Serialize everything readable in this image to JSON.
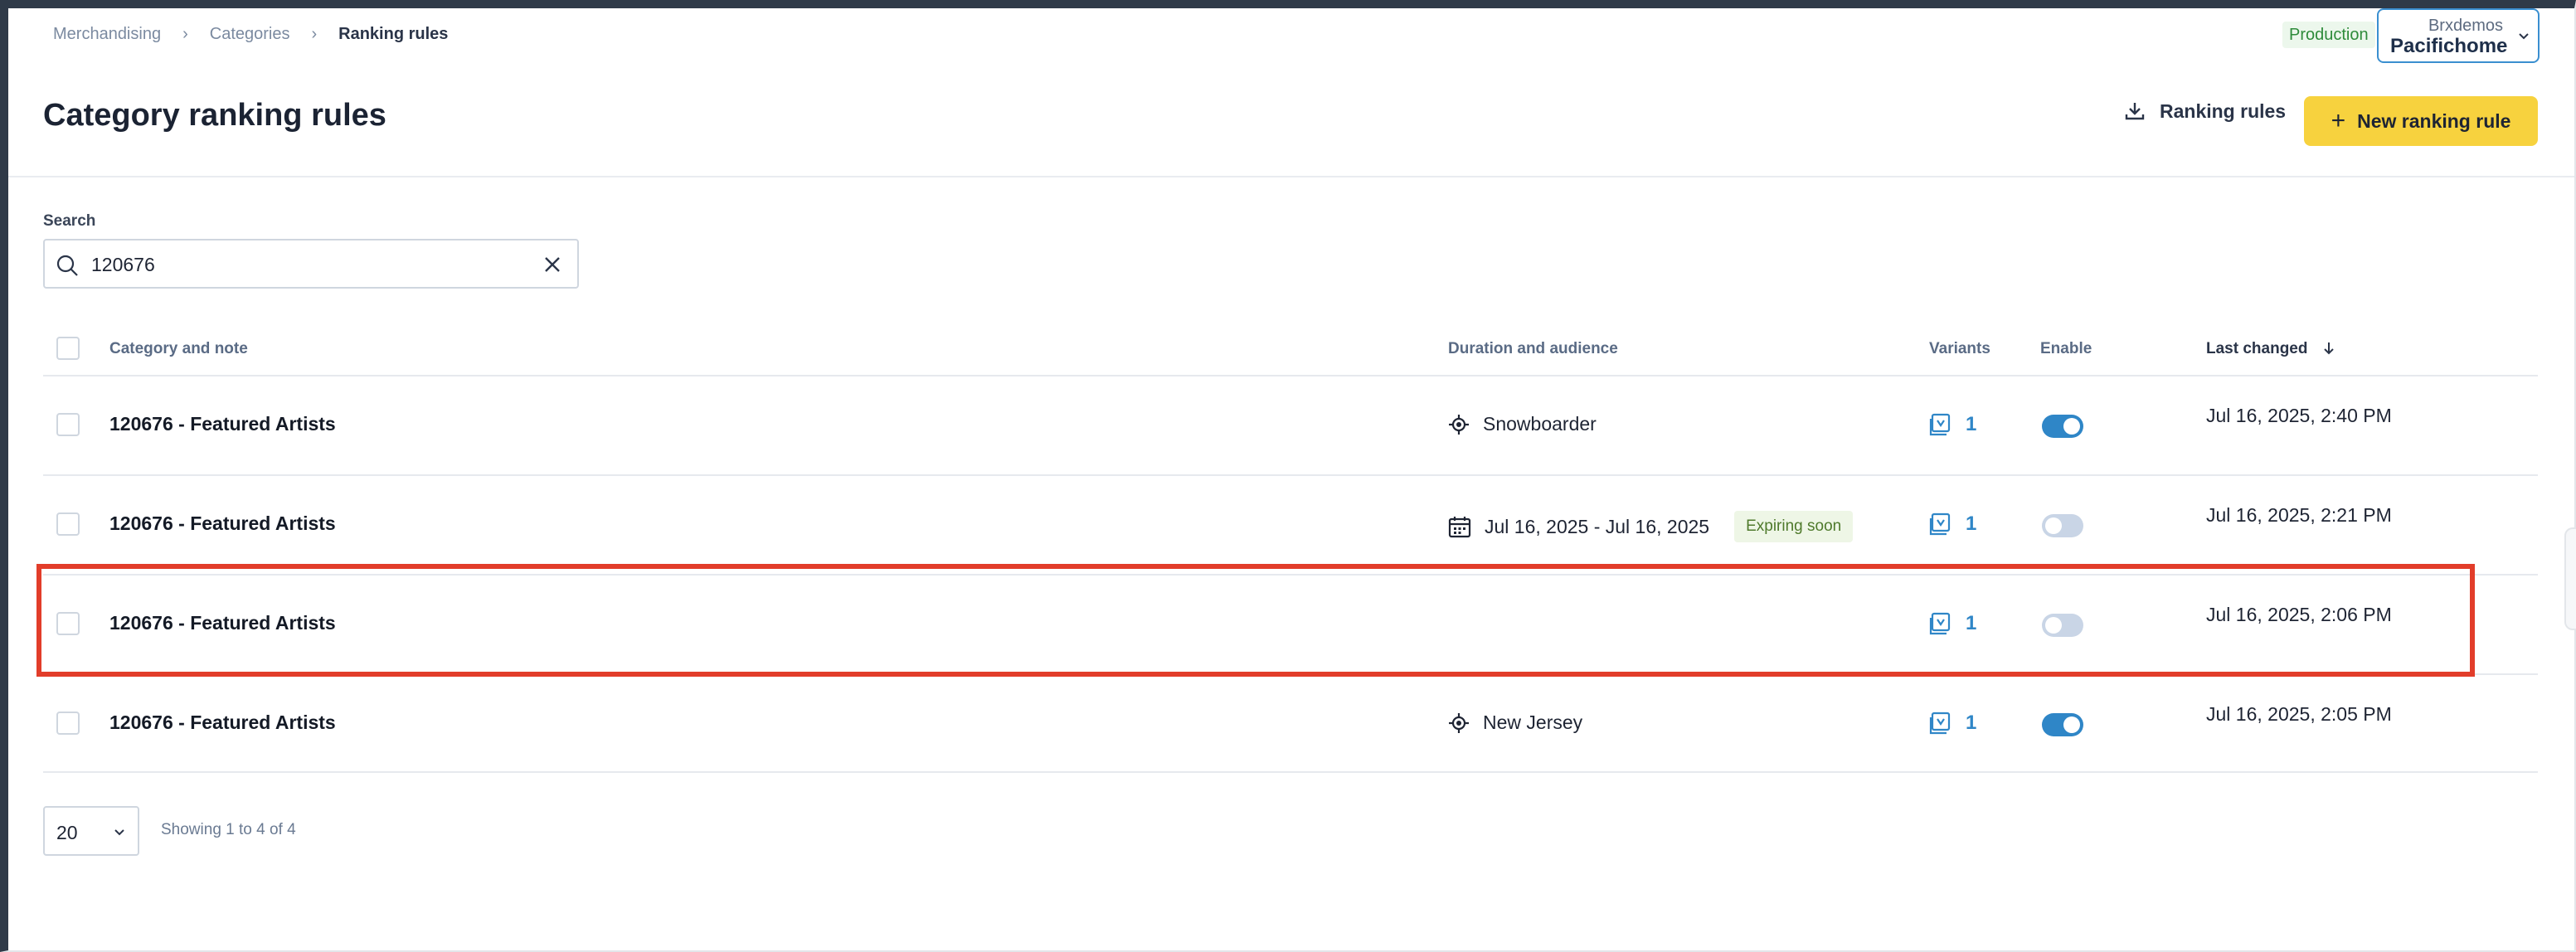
{
  "breadcrumb": [
    "Merchandising",
    "Categories",
    "Ranking rules"
  ],
  "environment": "Production",
  "account": {
    "org": "Brxdemos",
    "name": "Pacifichome"
  },
  "page_title": "Category ranking rules",
  "export_button": "Ranking rules",
  "new_button": "New ranking rule",
  "search": {
    "label": "Search",
    "value": "120676"
  },
  "table": {
    "headers": {
      "category": "Category and note",
      "duration": "Duration and audience",
      "variants": "Variants",
      "enable": "Enable",
      "last_changed": "Last changed"
    },
    "rows": [
      {
        "title": "120676 - Featured Artists",
        "audience_type": "location",
        "audience": "Snowboarder",
        "badge": "",
        "variants": "1",
        "enabled": true,
        "last_changed": "Jul 16, 2025, 2:40 PM"
      },
      {
        "title": "120676 - Featured Artists",
        "audience_type": "date",
        "audience": "Jul 16, 2025 - Jul 16, 2025",
        "badge": "Expiring soon",
        "variants": "1",
        "enabled": false,
        "last_changed": "Jul 16, 2025, 2:21 PM"
      },
      {
        "title": "120676 - Featured Artists",
        "audience_type": "none",
        "audience": "",
        "badge": "",
        "variants": "1",
        "enabled": false,
        "last_changed": "Jul 16, 2025, 2:06 PM",
        "highlighted": true
      },
      {
        "title": "120676 - Featured Artists",
        "audience_type": "location",
        "audience": "New Jersey",
        "badge": "",
        "variants": "1",
        "enabled": true,
        "last_changed": "Jul 16, 2025, 2:05 PM"
      }
    ]
  },
  "pagination": {
    "page_size": "20",
    "showing": "Showing 1 to 4 of 4"
  },
  "colors": {
    "accent": "#2f86c7",
    "primary_button": "#f7d23e",
    "highlight": "#e23d2a",
    "env": "#2e8b3a"
  }
}
